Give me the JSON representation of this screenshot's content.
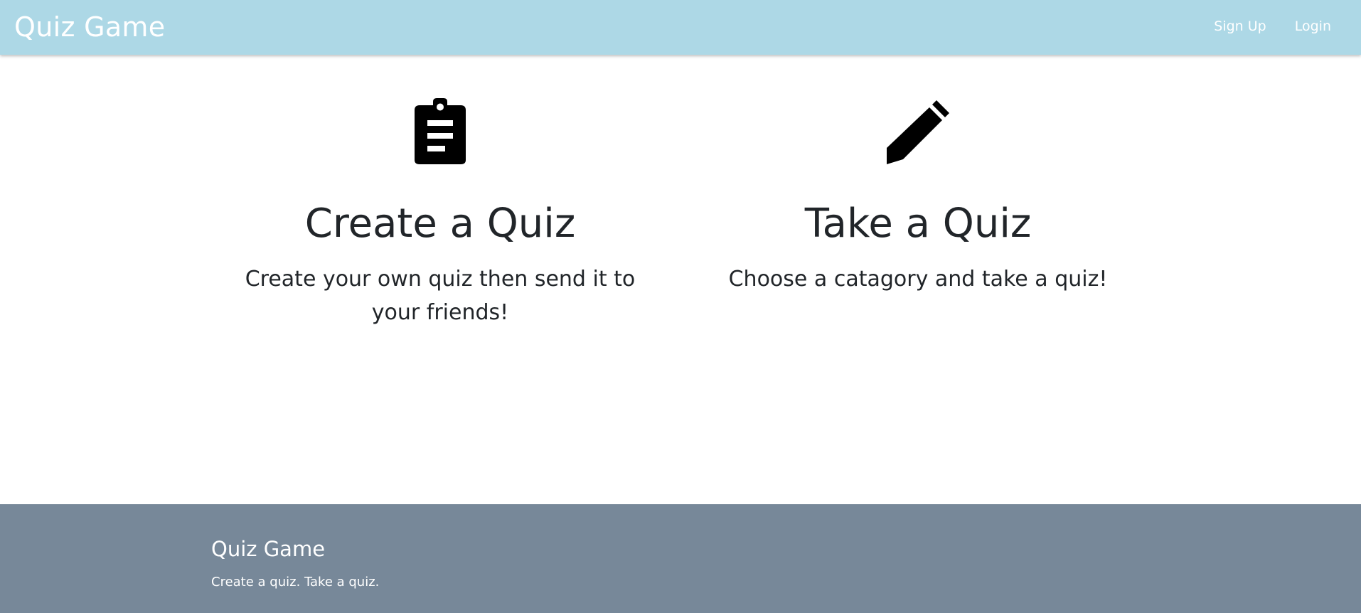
{
  "navbar": {
    "brand": "Quiz Game",
    "links": [
      "Sign Up",
      "Login"
    ],
    "background": "#add8e6"
  },
  "features": [
    {
      "icon": "clipboard-icon",
      "title": "Create a Quiz",
      "text": "Create your own quiz then send it to your friends!"
    },
    {
      "icon": "pencil-icon",
      "title": "Take a Quiz",
      "text": "Choose a catagory and take a quiz!"
    }
  ],
  "footer": {
    "title": "Quiz Game",
    "text": "Create a quiz. Take a quiz.",
    "background": "#778899"
  }
}
